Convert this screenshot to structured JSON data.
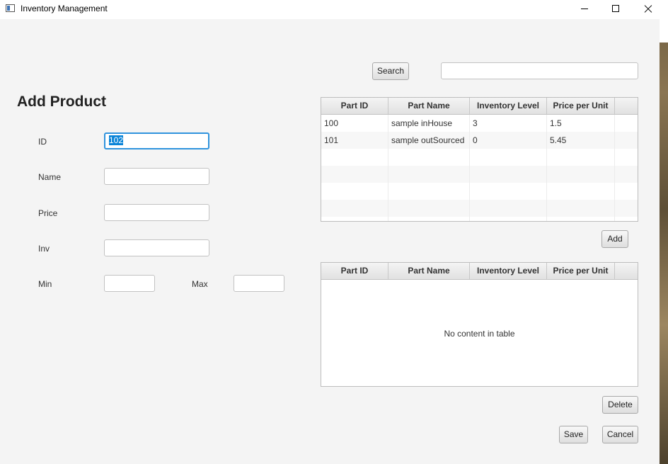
{
  "window": {
    "title": "Inventory Management"
  },
  "form": {
    "heading": "Add Product",
    "id_label": "ID",
    "id_value": "102",
    "name_label": "Name",
    "name_value": "",
    "price_label": "Price",
    "price_value": "",
    "inv_label": "Inv",
    "inv_value": "",
    "min_label": "Min",
    "min_value": "",
    "max_label": "Max",
    "max_value": ""
  },
  "search": {
    "button_label": "Search",
    "value": ""
  },
  "parts_table": {
    "columns": [
      "Part ID",
      "Part Name",
      "Inventory Level",
      "Price per Unit"
    ],
    "rows": [
      {
        "id": "100",
        "name": "sample inHouse",
        "inv": "3",
        "price": "1.5"
      },
      {
        "id": "101",
        "name": "sample outSourced",
        "inv": "0",
        "price": "5.45"
      }
    ]
  },
  "add_button_label": "Add",
  "product_parts_table": {
    "columns": [
      "Part ID",
      "Part Name",
      "Inventory Level",
      "Price per Unit"
    ],
    "empty_message": "No content in table"
  },
  "delete_button_label": "Delete",
  "save_button_label": "Save",
  "cancel_button_label": "Cancel"
}
